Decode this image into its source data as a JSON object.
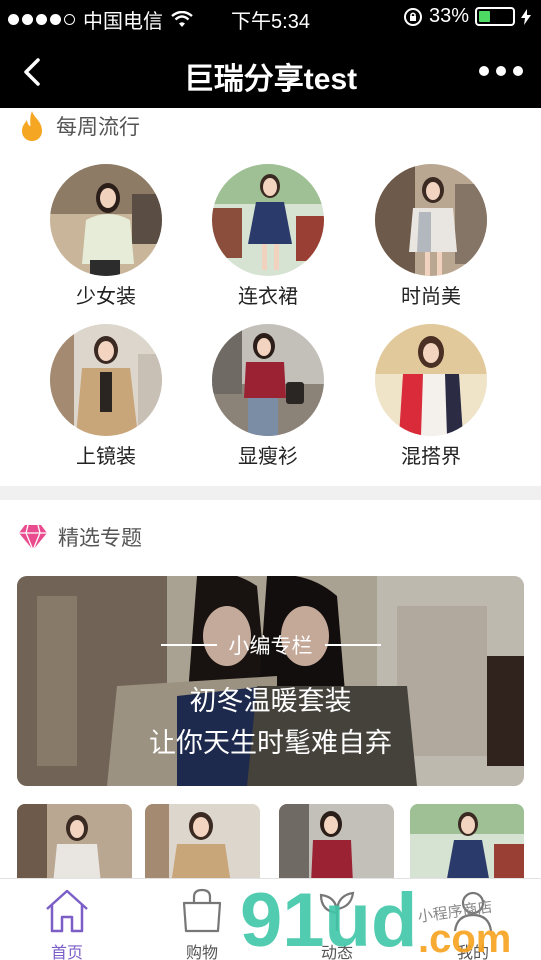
{
  "status_bar": {
    "carrier": "中国电信",
    "time": "下午5:34",
    "battery": "33%",
    "battery_level": 0.33
  },
  "nav": {
    "title": "巨瑞分享test"
  },
  "weekly": {
    "title": "每周流行",
    "items": [
      {
        "label": "少女装"
      },
      {
        "label": "连衣裙"
      },
      {
        "label": "时尚美"
      },
      {
        "label": "上镜装"
      },
      {
        "label": "显瘦衫"
      },
      {
        "label": "混搭界"
      }
    ]
  },
  "topics": {
    "title": "精选专题",
    "banner": {
      "tag": "小编专栏",
      "line1": "初冬温暖套装",
      "line2": "让你天生时髦难自弃"
    }
  },
  "tabs": [
    {
      "label": "首页",
      "icon": "home-icon",
      "active": true
    },
    {
      "label": "购物",
      "icon": "bag-icon",
      "active": false
    },
    {
      "label": "动态",
      "icon": "leaf-icon",
      "active": false
    },
    {
      "label": "我的",
      "icon": "user-icon",
      "active": false
    }
  ],
  "watermark": {
    "brand": "91ud.com",
    "slogan": "小程序商店"
  },
  "colors": {
    "accent": "#7b5fc7",
    "fire": "#f5a623",
    "diamond": "#e94c8e",
    "watermark_green": "#3ec6a8",
    "watermark_orange": "#f7a21d"
  }
}
